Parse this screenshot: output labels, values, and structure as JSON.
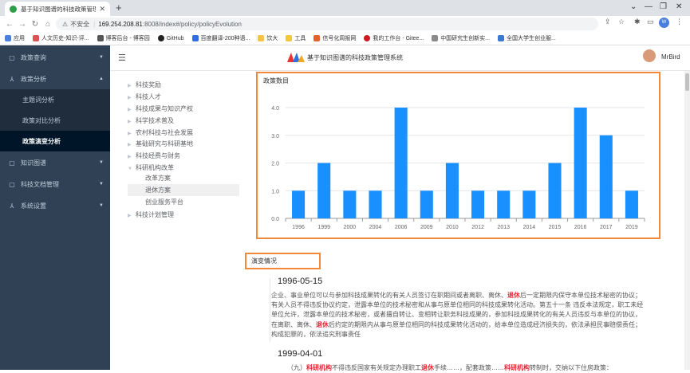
{
  "browser": {
    "tab_title": "基于知识图谱的科技政策管理系",
    "security_label": "不安全",
    "url_host": "169.254.208.81",
    "url_path": ":8008/index#/policy/policyEvolution",
    "bookmarks": [
      "应用",
      "人文历史-知识-评...",
      "博客后台 - 博客园",
      "GitHub",
      "百度翻译-200种语...",
      "饮大",
      "工具",
      "信号化周报网",
      "我的工作台 - Gitee...",
      "中国研究生创新实...",
      "全国大学生创业服..."
    ]
  },
  "sidebar": {
    "items": [
      {
        "label": "政策查询",
        "icon": "doc-icon",
        "expanded": false
      },
      {
        "label": "政策分析",
        "icon": "network-icon",
        "expanded": true
      },
      {
        "label": "知识图谱",
        "icon": "doc-icon",
        "expanded": false
      },
      {
        "label": "科技文档管理",
        "icon": "doc-icon",
        "expanded": false
      },
      {
        "label": "系统设置",
        "icon": "network-icon",
        "expanded": false
      }
    ],
    "subitems": [
      {
        "label": "主题词分析",
        "active": false
      },
      {
        "label": "政策对比分析",
        "active": false
      },
      {
        "label": "政策演变分析",
        "active": true
      }
    ]
  },
  "header": {
    "title": "基于知识图谱的科技政策管理系统",
    "user": "MrBird"
  },
  "tree": {
    "top": [
      "科技奖励",
      "科技人才",
      "科技成果与知识产权",
      "科学技术普及",
      "农村科技与社会发展",
      "基础研究与科研基地",
      "科技经费与财务",
      "科研机构改革"
    ],
    "children": [
      "改革方案",
      "退休方案",
      "创业服务平台"
    ],
    "last": "科技计划管理",
    "selected_child": "退休方案"
  },
  "chart_data": {
    "type": "bar",
    "title": "政策数目",
    "categories": [
      "1996",
      "1999",
      "2000",
      "2004",
      "2006",
      "2009",
      "2010",
      "2012",
      "2013",
      "2014",
      "2015",
      "2016",
      "2017",
      "2019"
    ],
    "values": [
      1,
      2,
      1,
      1,
      4,
      1,
      2,
      1,
      1,
      1,
      2,
      4,
      3,
      1
    ],
    "ylim": [
      0,
      4
    ],
    "yticks": [
      "0.0",
      "1.0",
      "2.0",
      "3.0",
      "4.0"
    ],
    "bar_color": "#1890ff",
    "grid": true
  },
  "evolution": {
    "label": "演变情况",
    "entries": [
      {
        "date": "1996-05-15",
        "text_a": "企业、事业单位可以与参加科技成果转化的有关人员签订在职期间或者离职、离休、",
        "hl_a": "退休",
        "text_b": "后一定期限内保守本单位技术秘密的协议；有关人员不得违反协议约定，泄露本单位的技术秘密和从事与原单位相同的科技成果转化活动。第五十一条 违反本法规定，职工未经单位允许，泄露本单位的技术秘密，或者擅自转让、变相转让职务科技成果的，参加科技成果转化的有关人员违反与本单位的协议，在离职、离休、",
        "hl_b": "退休",
        "text_c": "后约定的期限内从事与原单位相同的科技成果转化活动的，给本单位造成经济损失的，依法承担民事赔偿责任；构成犯罪的，依法追究刑事责任"
      },
      {
        "date": "1999-04-01",
        "text_a": "（九）",
        "hl_a": "科研机构",
        "text_b": "不得违反国家有关规定办理职工",
        "hl_b": "退休",
        "text_c": "手续……，配套政策……",
        "hl_c": "科研机构",
        "text_d": "转制时，交纳以下住房政策："
      }
    ]
  }
}
